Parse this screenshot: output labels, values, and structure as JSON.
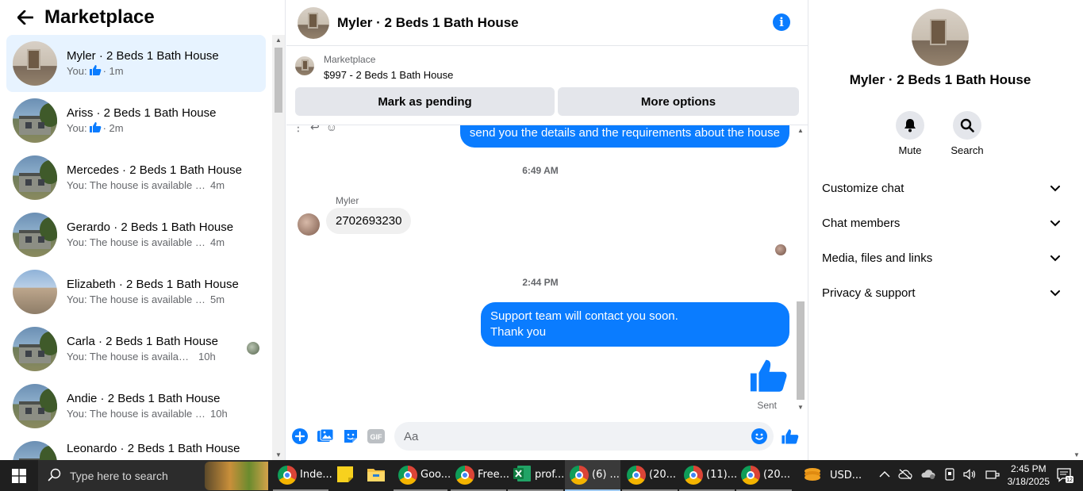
{
  "sidebar": {
    "title": "Marketplace",
    "conversations": [
      {
        "name": "Myler · 2 Beds 1 Bath House",
        "prefix": "You:",
        "snippet": "",
        "like": true,
        "time": "· 1m",
        "active": true,
        "thumb": "room",
        "seen": false
      },
      {
        "name": "Ariss · 2 Beds 1 Bath House",
        "prefix": "You:",
        "snippet": "",
        "like": true,
        "time": "· 2m",
        "active": false,
        "thumb": "house",
        "seen": false
      },
      {
        "name": "Mercedes · 2 Beds 1 Bath House",
        "prefix": "",
        "snippet": "You: The house is available for ren...",
        "like": false,
        "time": "4m",
        "active": false,
        "thumb": "house",
        "seen": false
      },
      {
        "name": "Gerardo · 2 Beds 1 Bath House",
        "prefix": "",
        "snippet": "You: The house is available for ren...",
        "like": false,
        "time": "4m",
        "active": false,
        "thumb": "house",
        "seen": false
      },
      {
        "name": "Elizabeth · 2 Beds 1 Bath House",
        "prefix": "",
        "snippet": "You: The house is available for ren...",
        "like": false,
        "time": "5m",
        "active": false,
        "thumb": "desert",
        "seen": false
      },
      {
        "name": "Carla · 2 Beds 1 Bath House",
        "prefix": "",
        "snippet": "You: The house is available for ...",
        "like": false,
        "time": "10h",
        "active": false,
        "thumb": "house",
        "seen": true
      },
      {
        "name": "Andie · 2 Beds 1 Bath House",
        "prefix": "",
        "snippet": "You: The house is available for ren...",
        "like": false,
        "time": "10h",
        "active": false,
        "thumb": "house",
        "seen": false
      },
      {
        "name": "Leonardo · 2 Beds 1 Bath House",
        "prefix": "",
        "snippet": "",
        "like": false,
        "time": "",
        "active": false,
        "thumb": "house",
        "seen": false
      }
    ]
  },
  "chat": {
    "title": "Myler · 2 Beds 1 Bath House",
    "listing": {
      "category": "Marketplace",
      "price_title": "$997 - 2 Beds 1 Bath House"
    },
    "buttons": {
      "pending": "Mark as pending",
      "more": "More options"
    },
    "messages": {
      "out_partial": "send you the details and the requirements about the house",
      "time1": "6:49 AM",
      "sender": "Myler",
      "in_msg": "2702693230",
      "time2": "2:44 PM",
      "out_msg_line1": "Support team will contact you soon.",
      "out_msg_line2": "Thank you",
      "status": "Sent"
    },
    "composer": {
      "placeholder": "Aa"
    }
  },
  "info": {
    "name": "Myler · 2 Beds 1 Bath House",
    "actions": {
      "mute": "Mute",
      "search": "Search"
    },
    "sections": [
      "Customize chat",
      "Chat members",
      "Media, files and links",
      "Privacy & support"
    ]
  },
  "taskbar": {
    "search_placeholder": "Type here to search",
    "apps": [
      {
        "label": "Inde...",
        "icon": "chrome"
      },
      {
        "label": "",
        "icon": "sticky-notes"
      },
      {
        "label": "",
        "icon": "file-explorer"
      },
      {
        "label": "Goo...",
        "icon": "chrome"
      },
      {
        "label": "Free...",
        "icon": "chrome"
      },
      {
        "label": "prof...",
        "icon": "excel"
      },
      {
        "label": "(6) ...",
        "icon": "chrome"
      },
      {
        "label": "(20...",
        "icon": "chrome"
      },
      {
        "label": "(11)...",
        "icon": "chrome"
      },
      {
        "label": "(20...",
        "icon": "chrome"
      }
    ],
    "currency": "USD...",
    "time": "2:45 PM",
    "date": "3/18/2025",
    "notifications": "12"
  },
  "colors": {
    "accent": "#0a7cff",
    "active_row": "#e7f3ff",
    "button_gray": "#e4e6eb",
    "taskbar": "#1f1f1f"
  }
}
